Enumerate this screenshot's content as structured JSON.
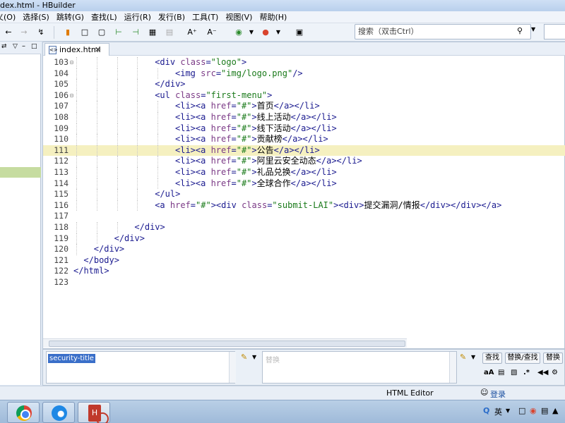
{
  "window": {
    "title": "dex.html  -  HBuilder"
  },
  "menu": [
    "义(O)",
    "选择(S)",
    "跳转(G)",
    "查找(L)",
    "运行(R)",
    "发行(B)",
    "工具(T)",
    "视图(V)",
    "帮助(H)"
  ],
  "search": {
    "placeholder": "搜索（双击Ctrl）"
  },
  "tab": {
    "label": "index.html",
    "close": "✕"
  },
  "code": [
    {
      "n": "103",
      "fold": true,
      "indent": 8,
      "tokens": [
        [
          "tag",
          "<div "
        ],
        [
          "attr",
          "class"
        ],
        [
          "tag",
          "="
        ],
        [
          "str",
          "\"logo\""
        ],
        [
          "tag",
          ">"
        ]
      ]
    },
    {
      "n": "104",
      "fold": false,
      "indent": 10,
      "tokens": [
        [
          "tag",
          "<img "
        ],
        [
          "attr",
          "src"
        ],
        [
          "tag",
          "="
        ],
        [
          "str",
          "\"img/logo.png\""
        ],
        [
          "tag",
          "/>"
        ]
      ]
    },
    {
      "n": "105",
      "fold": false,
      "indent": 8,
      "tokens": [
        [
          "tag",
          "</div>"
        ]
      ]
    },
    {
      "n": "106",
      "fold": true,
      "indent": 8,
      "tokens": [
        [
          "tag",
          "<ul "
        ],
        [
          "attr",
          "class"
        ],
        [
          "tag",
          "="
        ],
        [
          "str",
          "\"first-menu\""
        ],
        [
          "tag",
          ">"
        ]
      ]
    },
    {
      "n": "107",
      "fold": false,
      "indent": 10,
      "tokens": [
        [
          "tag",
          "<li><a "
        ],
        [
          "attr",
          "href"
        ],
        [
          "tag",
          "="
        ],
        [
          "str",
          "\"#\""
        ],
        [
          "tag",
          ">"
        ],
        [
          "txt",
          "首页"
        ],
        [
          "tag",
          "</a></li>"
        ]
      ]
    },
    {
      "n": "108",
      "fold": false,
      "indent": 10,
      "tokens": [
        [
          "tag",
          "<li><a "
        ],
        [
          "attr",
          "href"
        ],
        [
          "tag",
          "="
        ],
        [
          "str",
          "\"#\""
        ],
        [
          "tag",
          ">"
        ],
        [
          "txt",
          "线上活动"
        ],
        [
          "tag",
          "</a></li>"
        ]
      ]
    },
    {
      "n": "109",
      "fold": false,
      "indent": 10,
      "tokens": [
        [
          "tag",
          "<li><a "
        ],
        [
          "attr",
          "href"
        ],
        [
          "tag",
          "="
        ],
        [
          "str",
          "\"#\""
        ],
        [
          "tag",
          ">"
        ],
        [
          "txt",
          "线下活动"
        ],
        [
          "tag",
          "</a></li>"
        ]
      ]
    },
    {
      "n": "110",
      "fold": false,
      "indent": 10,
      "tokens": [
        [
          "tag",
          "<li><a "
        ],
        [
          "attr",
          "href"
        ],
        [
          "tag",
          "="
        ],
        [
          "str",
          "\"#\""
        ],
        [
          "tag",
          ">"
        ],
        [
          "txt",
          "贡献榜"
        ],
        [
          "tag",
          "</a></li>"
        ]
      ]
    },
    {
      "n": "111",
      "fold": false,
      "indent": 10,
      "current": true,
      "tokens": [
        [
          "tag",
          "<li><a "
        ],
        [
          "attr",
          "href"
        ],
        [
          "tag",
          "="
        ],
        [
          "str",
          "\"#\""
        ],
        [
          "tag",
          ">"
        ],
        [
          "txt",
          "公告"
        ],
        [
          "tag",
          "</a></li>"
        ]
      ]
    },
    {
      "n": "112",
      "fold": false,
      "indent": 10,
      "tokens": [
        [
          "tag",
          "<li><a "
        ],
        [
          "attr",
          "href"
        ],
        [
          "tag",
          "="
        ],
        [
          "str",
          "\"#\""
        ],
        [
          "tag",
          ">"
        ],
        [
          "txt",
          "阿里云安全动态"
        ],
        [
          "tag",
          "</a></li>"
        ]
      ]
    },
    {
      "n": "113",
      "fold": false,
      "indent": 10,
      "tokens": [
        [
          "tag",
          "<li><a "
        ],
        [
          "attr",
          "href"
        ],
        [
          "tag",
          "="
        ],
        [
          "str",
          "\"#\""
        ],
        [
          "tag",
          ">"
        ],
        [
          "txt",
          "礼品兑换"
        ],
        [
          "tag",
          "</a></li>"
        ]
      ]
    },
    {
      "n": "114",
      "fold": false,
      "indent": 10,
      "tokens": [
        [
          "tag",
          "<li><a "
        ],
        [
          "attr",
          "href"
        ],
        [
          "tag",
          "="
        ],
        [
          "str",
          "\"#\""
        ],
        [
          "tag",
          ">"
        ],
        [
          "txt",
          "全球合作"
        ],
        [
          "tag",
          "</a></li>"
        ]
      ]
    },
    {
      "n": "115",
      "fold": false,
      "indent": 8,
      "tokens": [
        [
          "tag",
          "</ul>"
        ]
      ]
    },
    {
      "n": "116",
      "fold": false,
      "indent": 8,
      "tokens": [
        [
          "tag",
          "<a "
        ],
        [
          "attr",
          "href"
        ],
        [
          "tag",
          "="
        ],
        [
          "str",
          "\"#\""
        ],
        [
          "tag",
          "><div "
        ],
        [
          "attr",
          "class"
        ],
        [
          "tag",
          "="
        ],
        [
          "str",
          "\"submit-LAI\""
        ],
        [
          "tag",
          "><div>"
        ],
        [
          "txt",
          "提交漏洞/情报"
        ],
        [
          "tag",
          "</div></div></a>"
        ]
      ]
    },
    {
      "n": "117",
      "fold": false,
      "indent": 0,
      "tokens": []
    },
    {
      "n": "118",
      "fold": false,
      "indent": 6,
      "tokens": [
        [
          "tag",
          "</div>"
        ]
      ]
    },
    {
      "n": "119",
      "fold": false,
      "indent": 4,
      "tokens": [
        [
          "tag",
          "</div>"
        ]
      ]
    },
    {
      "n": "120",
      "fold": false,
      "indent": 2,
      "tokens": [
        [
          "tag",
          "</div>"
        ]
      ]
    },
    {
      "n": "121",
      "fold": false,
      "indent": 1,
      "tokens": [
        [
          "tag",
          "</body>"
        ]
      ]
    },
    {
      "n": "122",
      "fold": false,
      "indent": 0,
      "tokens": [
        [
          "tag",
          "</html>"
        ]
      ]
    },
    {
      "n": "123",
      "fold": false,
      "indent": 0,
      "tokens": []
    }
  ],
  "find": {
    "query": "security-title",
    "replace_placeholder": "替换",
    "find_button": "查找",
    "replace_find_button": "替换/查找",
    "replace_button": "替换",
    "case_label": "aA",
    "regex_label": ".*"
  },
  "status": {
    "mode": "HTML Editor",
    "login": "登录"
  },
  "taskbar": {
    "hb_label": "H"
  },
  "tray": {
    "ime": "英"
  }
}
